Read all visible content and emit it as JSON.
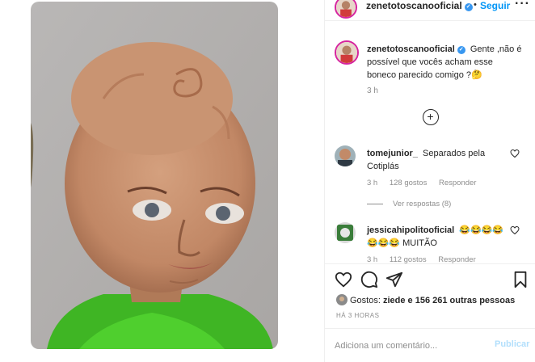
{
  "header": {
    "username": "zenetotoscanooficial",
    "separator": "•",
    "follow_label": "Seguir",
    "more_label": "···"
  },
  "caption": {
    "username": "zenetotoscanooficial",
    "text": "Gente ,não é possível que vocês acham esse boneco parecido comigo ?🤔",
    "time": "3 h"
  },
  "comments": [
    {
      "username": "tomejunior_",
      "text": "Separados pela Cotiplás",
      "time": "3 h",
      "likes": "128 gostos",
      "reply_label": "Responder",
      "view_replies": "Ver respostas (8)"
    },
    {
      "username": "jessicahipolitooficial",
      "text": "😂😂😂😂😂😂😂 MUITÃO",
      "time": "3 h",
      "likes": "112 gostos",
      "reply_label": "Responder"
    }
  ],
  "likes": {
    "prefix": "Gostos:",
    "user": "ziede",
    "suffix": "e 156 261 outras pessoas"
  },
  "posted_ago": "HÁ 3 HORAS",
  "add_comment": {
    "placeholder": "Adiciona um comentário...",
    "post_label": "Publicar"
  },
  "colors": {
    "link_blue": "#0095f6",
    "verified_blue": "#3897f0",
    "muted": "#8e8e8e",
    "shirt_green": "#3fb524"
  },
  "icons": [
    "verified-icon",
    "add-circle-icon",
    "heart-icon",
    "comment-icon",
    "share-icon",
    "bookmark-icon"
  ]
}
